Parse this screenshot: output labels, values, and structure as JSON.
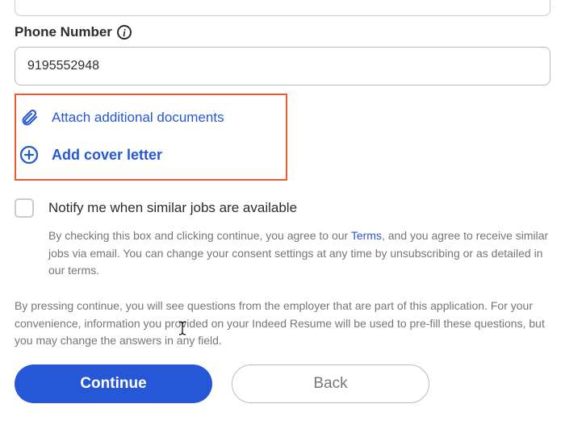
{
  "phone": {
    "label": "Phone Number",
    "value": "9195552948"
  },
  "attachments": {
    "attach_label": "Attach additional documents",
    "cover_label": "Add cover letter"
  },
  "notify": {
    "label": "Notify me when similar jobs are available",
    "consent_before": "By checking this box and clicking continue, you agree to our ",
    "terms_text": "Terms",
    "consent_after": ", and you agree to receive similar jobs via email. You can change your consent settings at any time by unsubscribing or as detailed in our terms."
  },
  "continue_notice": "By pressing continue, you will see questions from the employer that are part of this application. For your convenience, information you provided on your Indeed Resume will be used to pre-fill these questions, but you may change the answers in any field.",
  "buttons": {
    "continue": "Continue",
    "back": "Back"
  }
}
